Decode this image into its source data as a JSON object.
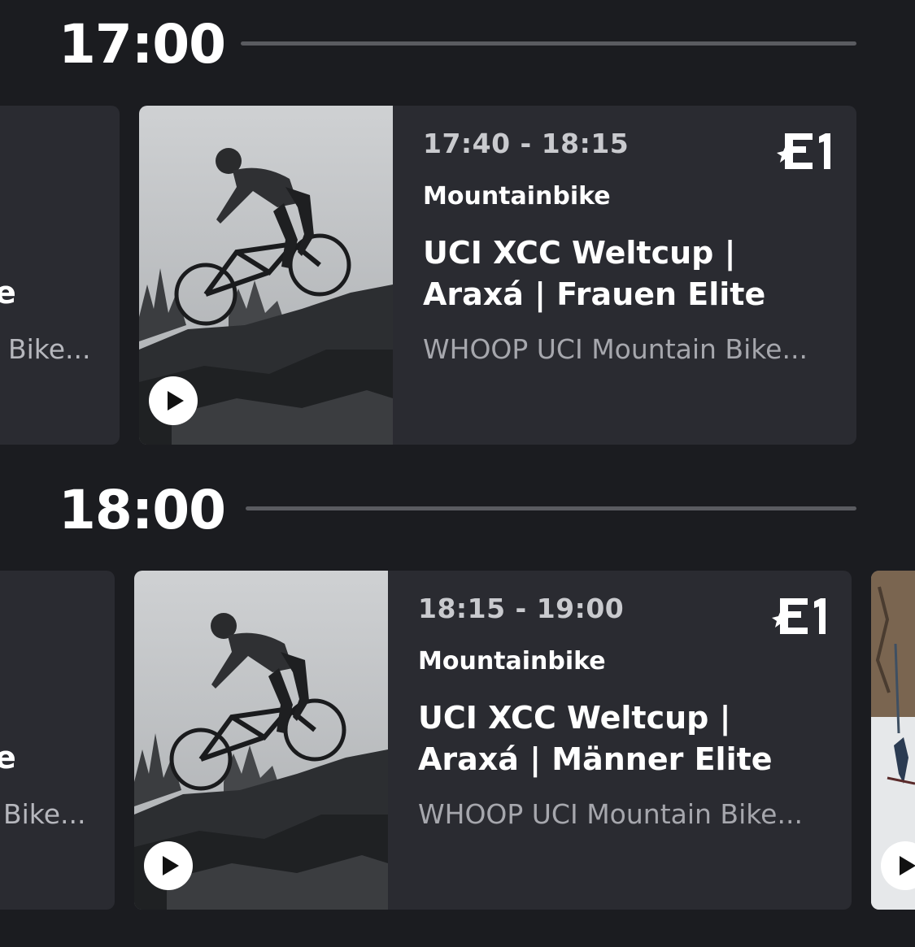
{
  "schedule": [
    {
      "hour": "17:00",
      "prev_card": {
        "title_fragment": "e",
        "subtitle_fragment": "Bike..."
      },
      "card": {
        "time": "17:40 - 18:15",
        "sport": "Mountainbike",
        "title": "UCI XCC Weltcup | Araxá | Frauen Elite",
        "subtitle": "WHOOP UCI Mountain Bike...",
        "channel_icon": "eurosport-1-logo",
        "play_icon": "play-icon"
      }
    },
    {
      "hour": "18:00",
      "prev_card": {
        "title_fragment": "e",
        "subtitle_fragment": "Bike..."
      },
      "card": {
        "time": "18:15 - 19:00",
        "sport": "Mountainbike",
        "title": "UCI XCC Weltcup | Araxá | Männer Elite",
        "subtitle": "WHOOP UCI Mountain Bike...",
        "channel_icon": "eurosport-1-logo",
        "play_icon": "play-icon"
      },
      "next_card": {
        "play_icon": "play-icon"
      }
    }
  ],
  "colors": {
    "background": "#1b1c20",
    "card": "#2a2b31",
    "divider": "#5a5b60",
    "secondary_text": "#a6a7ad"
  }
}
